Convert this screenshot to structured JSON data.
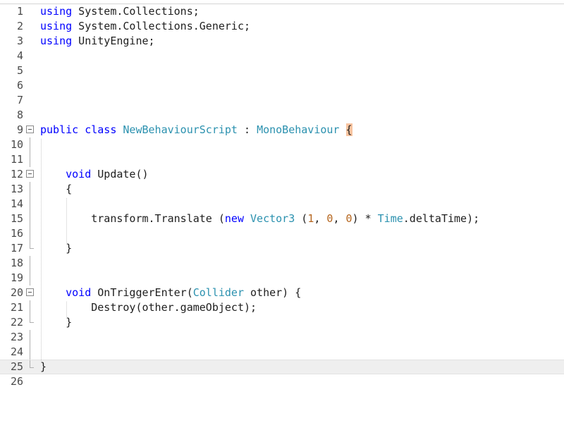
{
  "editor": {
    "current_line": 25,
    "lines": [
      {
        "n": "1",
        "tokens": [
          {
            "c": "kw",
            "t": "using"
          },
          {
            "c": "tx",
            "t": " System.Collections;"
          }
        ]
      },
      {
        "n": "2",
        "tokens": [
          {
            "c": "kw",
            "t": "using"
          },
          {
            "c": "tx",
            "t": " System.Collections.Generic;"
          }
        ]
      },
      {
        "n": "3",
        "tokens": [
          {
            "c": "kw",
            "t": "using"
          },
          {
            "c": "tx",
            "t": " UnityEngine;"
          }
        ]
      },
      {
        "n": "4",
        "tokens": []
      },
      {
        "n": "5",
        "tokens": []
      },
      {
        "n": "6",
        "tokens": []
      },
      {
        "n": "7",
        "tokens": []
      },
      {
        "n": "8",
        "tokens": []
      },
      {
        "n": "9",
        "fold": "open",
        "tokens": [
          {
            "c": "kw",
            "t": "public"
          },
          {
            "c": "tx",
            "t": " "
          },
          {
            "c": "kw",
            "t": "class"
          },
          {
            "c": "tx",
            "t": " "
          },
          {
            "c": "typ",
            "t": "NewBehaviourScript"
          },
          {
            "c": "tx",
            "t": " : "
          },
          {
            "c": "typ",
            "t": "MonoBehaviour"
          },
          {
            "c": "tx",
            "t": " "
          },
          {
            "c": "brace-hl",
            "t": "{"
          }
        ]
      },
      {
        "n": "10",
        "fold": "line",
        "tokens": []
      },
      {
        "n": "11",
        "fold": "line",
        "tokens": []
      },
      {
        "n": "12",
        "fold": "open",
        "tokens": [
          {
            "c": "tx",
            "t": "    "
          },
          {
            "c": "kw",
            "t": "void"
          },
          {
            "c": "tx",
            "t": " Update()"
          }
        ]
      },
      {
        "n": "13",
        "fold": "line",
        "tokens": [
          {
            "c": "tx",
            "t": "    {"
          }
        ]
      },
      {
        "n": "14",
        "fold": "line",
        "tokens": []
      },
      {
        "n": "15",
        "fold": "line",
        "tokens": [
          {
            "c": "tx",
            "t": "        transform.Translate ("
          },
          {
            "c": "kw",
            "t": "new"
          },
          {
            "c": "tx",
            "t": " "
          },
          {
            "c": "typ",
            "t": "Vector3"
          },
          {
            "c": "tx",
            "t": " ("
          },
          {
            "c": "num",
            "t": "1"
          },
          {
            "c": "tx",
            "t": ", "
          },
          {
            "c": "num",
            "t": "0"
          },
          {
            "c": "tx",
            "t": ", "
          },
          {
            "c": "num",
            "t": "0"
          },
          {
            "c": "tx",
            "t": ") * "
          },
          {
            "c": "typ",
            "t": "Time"
          },
          {
            "c": "tx",
            "t": ".deltaTime);"
          }
        ]
      },
      {
        "n": "16",
        "fold": "line",
        "tokens": []
      },
      {
        "n": "17",
        "fold": "end",
        "tokens": [
          {
            "c": "tx",
            "t": "    }"
          }
        ]
      },
      {
        "n": "18",
        "fold": "line",
        "tokens": []
      },
      {
        "n": "19",
        "fold": "line",
        "tokens": []
      },
      {
        "n": "20",
        "fold": "open",
        "tokens": [
          {
            "c": "tx",
            "t": "    "
          },
          {
            "c": "kw",
            "t": "void"
          },
          {
            "c": "tx",
            "t": " OnTriggerEnter("
          },
          {
            "c": "typ",
            "t": "Collider"
          },
          {
            "c": "tx",
            "t": " other) {"
          }
        ]
      },
      {
        "n": "21",
        "fold": "line",
        "tokens": [
          {
            "c": "tx",
            "t": "        Destroy(other.gameObject);"
          }
        ]
      },
      {
        "n": "22",
        "fold": "end",
        "tokens": [
          {
            "c": "tx",
            "t": "    }"
          }
        ]
      },
      {
        "n": "23",
        "fold": "line",
        "tokens": []
      },
      {
        "n": "24",
        "fold": "line",
        "tokens": []
      },
      {
        "n": "25",
        "fold": "end",
        "tokens": [
          {
            "c": "brace-hl-none",
            "t": "}"
          }
        ]
      },
      {
        "n": "26",
        "tokens": []
      }
    ]
  },
  "colors": {
    "keyword": "#0000ff",
    "type": "#2b91af",
    "number": "#b5651d",
    "brace_highlight": "#f8c4a0",
    "current_line_bg": "#efefef"
  }
}
